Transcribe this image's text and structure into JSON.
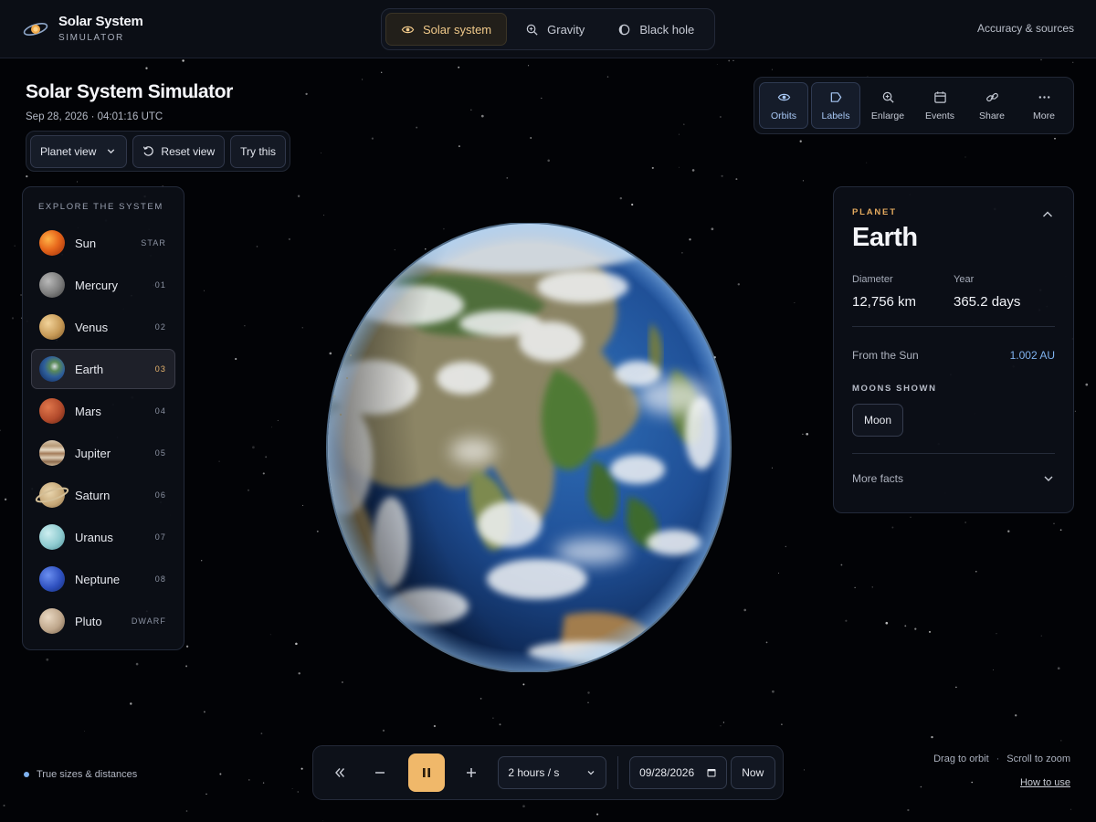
{
  "app": {
    "title": "Solar System",
    "subtitle": "SIMULATOR",
    "logo_icon": "orbit-logo-icon"
  },
  "modes": [
    {
      "label": "Solar system",
      "icon": "eye-icon",
      "active": true
    },
    {
      "label": "Gravity",
      "icon": "magnify-icon",
      "active": false
    },
    {
      "label": "Black hole",
      "icon": "moon-phase-icon",
      "active": false
    }
  ],
  "header_link": "Accuracy & sources",
  "page": {
    "title": "Solar System Simulator",
    "datetime": "Sep 28, 2026 · 04:01:16 UTC"
  },
  "view_controls": {
    "select_value": "Planet view",
    "reset_label": "Reset view",
    "try_label": "Try this"
  },
  "toolbar": [
    {
      "label": "Orbits",
      "icon": "eye-icon",
      "on": true
    },
    {
      "label": "Labels",
      "icon": "tag-icon",
      "on": true
    },
    {
      "label": "Enlarge",
      "icon": "zoom-in-icon",
      "on": false
    },
    {
      "label": "Events",
      "icon": "calendar-icon",
      "on": false
    },
    {
      "label": "Share",
      "icon": "link-icon",
      "on": false
    },
    {
      "label": "More",
      "icon": "more-dots-icon",
      "on": false
    }
  ],
  "explore": {
    "heading": "EXPLORE THE SYSTEM",
    "items": [
      {
        "name": "Sun",
        "code": "STAR",
        "active": false
      },
      {
        "name": "Mercury",
        "code": "01",
        "active": false
      },
      {
        "name": "Venus",
        "code": "02",
        "active": false
      },
      {
        "name": "Earth",
        "code": "03",
        "active": true
      },
      {
        "name": "Mars",
        "code": "04",
        "active": false
      },
      {
        "name": "Jupiter",
        "code": "05",
        "active": false
      },
      {
        "name": "Saturn",
        "code": "06",
        "active": false
      },
      {
        "name": "Uranus",
        "code": "07",
        "active": false
      },
      {
        "name": "Neptune",
        "code": "08",
        "active": false
      },
      {
        "name": "Pluto",
        "code": "DWARF",
        "active": false
      }
    ]
  },
  "info": {
    "kicker": "PLANET",
    "name": "Earth",
    "stats": [
      {
        "label": "Diameter",
        "value": "12,756 km"
      },
      {
        "label": "Year",
        "value": "365.2 days"
      }
    ],
    "distance_label": "From the Sun",
    "distance_value": "1.002 AU",
    "moons_heading": "MOONS SHOWN",
    "moons": [
      "Moon"
    ],
    "more_label": "More facts"
  },
  "footer": {
    "legend": "True sizes & distances",
    "hint_drag": "Drag to orbit",
    "hint_scroll": "Scroll to zoom",
    "how_to": "How to use"
  },
  "transport": {
    "speed": "2 hours / s",
    "date": "09/28/2026",
    "now_label": "Now",
    "playing": true
  },
  "colors": {
    "accent": "#f0b86a",
    "link_blue": "#7fb2ee",
    "panel_bg": "#0c1018",
    "header_bg": "#0b0e15"
  }
}
